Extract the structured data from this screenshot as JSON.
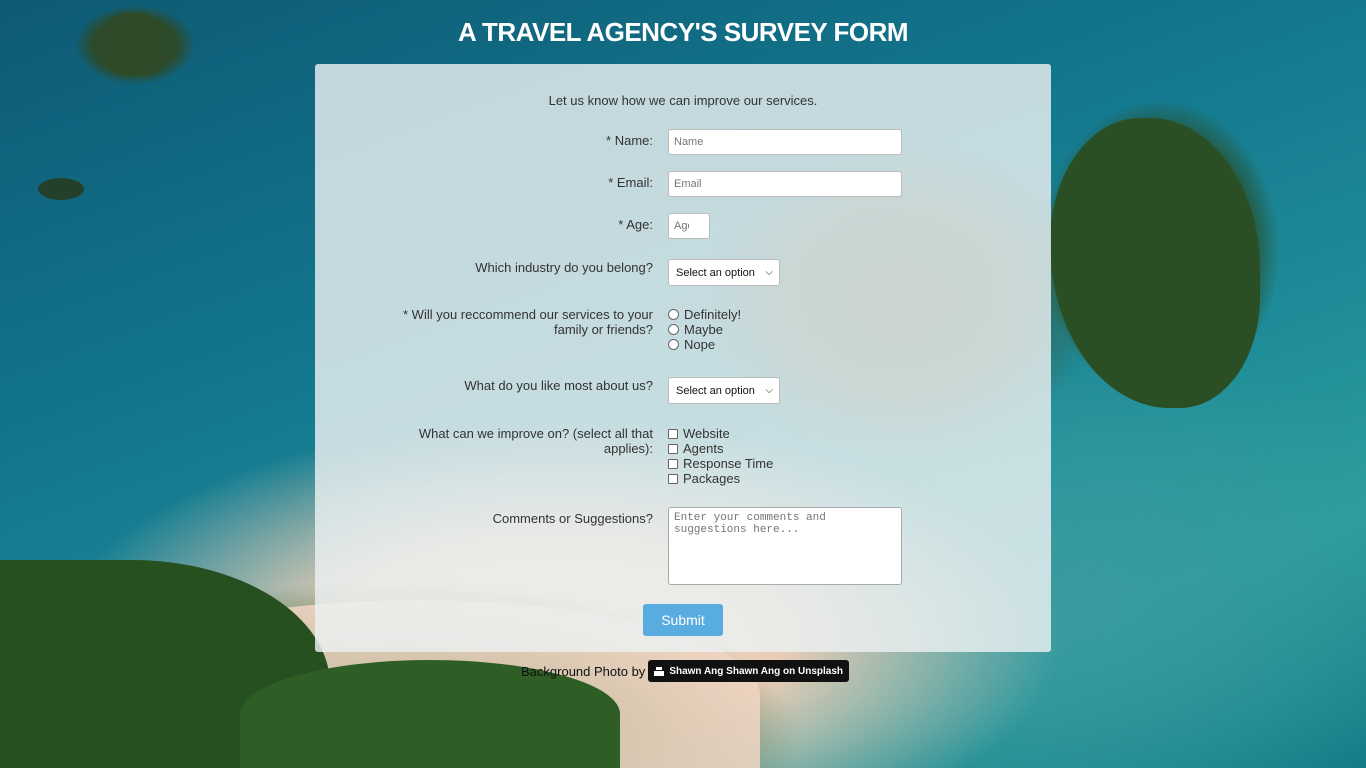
{
  "title": "A TRAVEL AGENCY'S SURVEY FORM",
  "intro": "Let us know how we can improve our services.",
  "fields": {
    "name": {
      "label": "* Name:",
      "placeholder": "Name"
    },
    "email": {
      "label": "* Email:",
      "placeholder": "Email"
    },
    "age": {
      "label": "* Age:",
      "placeholder": "Age"
    },
    "industry": {
      "label": "Which industry do you belong?",
      "selected": "Select an option"
    },
    "recommend": {
      "label": "* Will you reccommend our services to your family or friends?",
      "options": [
        "Definitely!",
        "Maybe",
        "Nope"
      ]
    },
    "like_most": {
      "label": "What do you like most about us?",
      "selected": "Select an option"
    },
    "improve": {
      "label": "What can we improve on? (select all that applies):",
      "options": [
        "Website",
        "Agents",
        "Response Time",
        "Packages"
      ]
    },
    "comments": {
      "label": "Comments or Suggestions?",
      "placeholder": "Enter your comments and suggestions here..."
    }
  },
  "submit_label": "Submit",
  "credit": {
    "text": "Background Photo by",
    "badge": "Shawn Ang Shawn Ang on Unsplash"
  }
}
